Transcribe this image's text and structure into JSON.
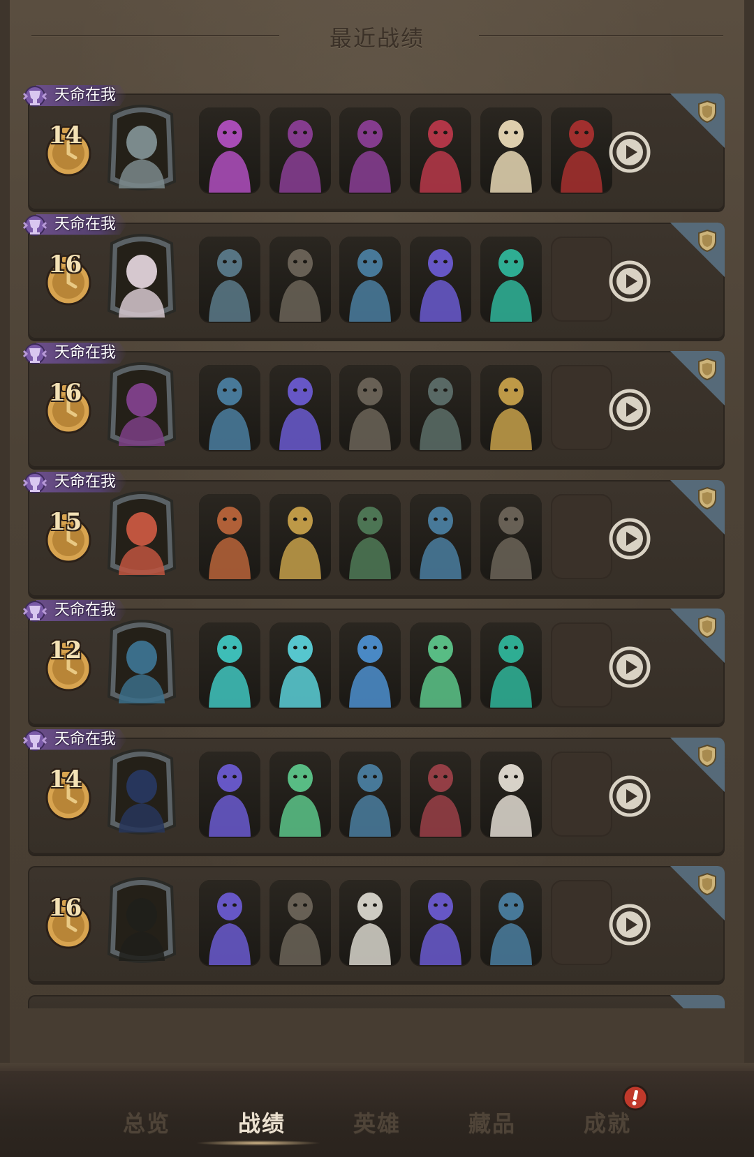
{
  "header": {
    "title": "最近战绩"
  },
  "records": [
    {
      "badge": "天命在我",
      "place": "14",
      "hero_color": "#7b8a8c",
      "units": [
        "#b04fbf",
        "#8a3e95",
        "#8a3e95",
        "#b8384a",
        "#e8d8b5",
        "#a8302f"
      ]
    },
    {
      "badge": "天命在我",
      "place": "16",
      "hero_color": "#d6c8cf",
      "units": [
        "#5a7a8a",
        "#6b6458",
        "#4a7ea0",
        "#6a5bd0",
        "#2fb59a"
      ]
    },
    {
      "badge": "天命在我",
      "place": "16",
      "hero_color": "#7c3f86",
      "units": [
        "#4a7ea0",
        "#6a5bd0",
        "#6b6458",
        "#5c6e69",
        "#c6a04a"
      ]
    },
    {
      "badge": "天命在我",
      "place": "15",
      "hero_color": "#c0553f",
      "units": [
        "#b8643a",
        "#c6a04a",
        "#4f7a57",
        "#4a7ea0",
        "#6b6458"
      ]
    },
    {
      "badge": "天命在我",
      "place": "12",
      "hero_color": "#3b6e8a",
      "units": [
        "#3fc6c0",
        "#5ad0d8",
        "#4c8fcf",
        "#5cc58a",
        "#2fb59a"
      ]
    },
    {
      "badge": "天命在我",
      "place": "14",
      "hero_color": "#27365c",
      "units": [
        "#6a5bd0",
        "#5cc58a",
        "#4a7ea0",
        "#9a4048",
        "#e2dcd2"
      ]
    },
    {
      "badge": "",
      "place": "16",
      "hero_color": "#1f1f1a",
      "units": [
        "#6a5bd0",
        "#6b6458",
        "#d8d6cc",
        "#6a5bd0",
        "#4a7ea0"
      ]
    }
  ],
  "tabs": [
    {
      "label": "总览",
      "active": false
    },
    {
      "label": "战绩",
      "active": true
    },
    {
      "label": "英雄",
      "active": false
    },
    {
      "label": "藏品",
      "active": false
    },
    {
      "label": "成就",
      "active": false
    }
  ],
  "alert_icon": "exclamation-icon",
  "colors": {
    "accent_purple": "#6b4e8a",
    "medal_gold": "#d8a450",
    "corner_blue": "#566a79",
    "alert_red": "#c0392b"
  }
}
